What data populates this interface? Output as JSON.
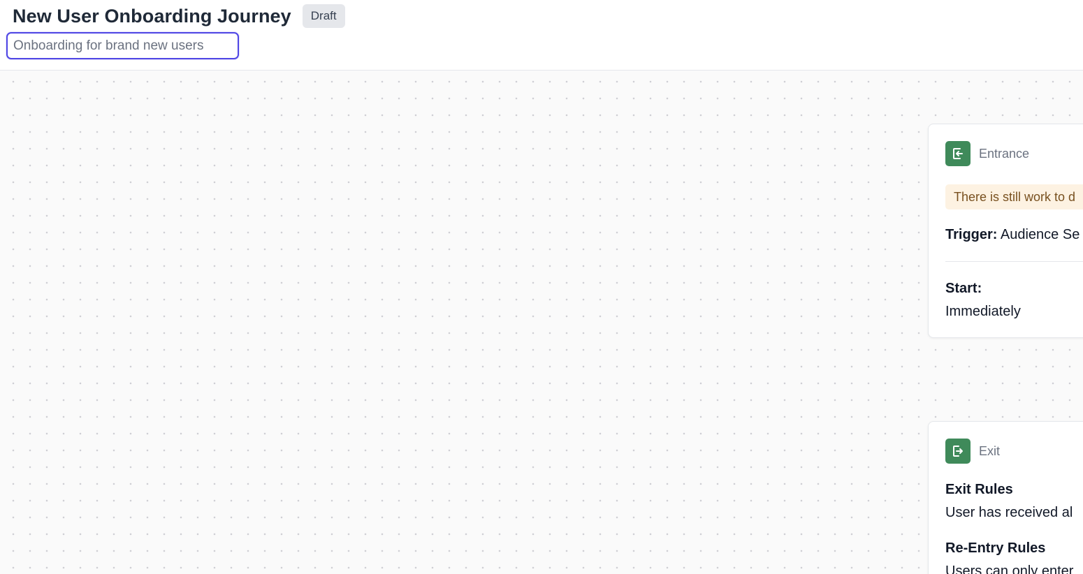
{
  "header": {
    "title": "New User Onboarding Journey",
    "status": "Draft",
    "description_value": "Onboarding for brand new users"
  },
  "canvas": {
    "entrance": {
      "type_label": "Entrance",
      "icon": "enter-icon",
      "warning": "There is still work to d",
      "trigger_label": "Trigger:",
      "trigger_value": "Audience Se",
      "start_label": "Start:",
      "start_value": "Immediately"
    },
    "exit": {
      "type_label": "Exit",
      "icon": "exit-icon",
      "exit_rules_label": "Exit Rules",
      "exit_rules_value": "User has received al",
      "reentry_label": "Re-Entry Rules",
      "reentry_value": "Users can only enter"
    }
  },
  "colors": {
    "accent": "#4f46e5",
    "node_icon": "#3f8a5a",
    "warning_bg": "#fdf2e2",
    "warning_text": "#78501f",
    "badge_bg": "#e5e7eb"
  }
}
